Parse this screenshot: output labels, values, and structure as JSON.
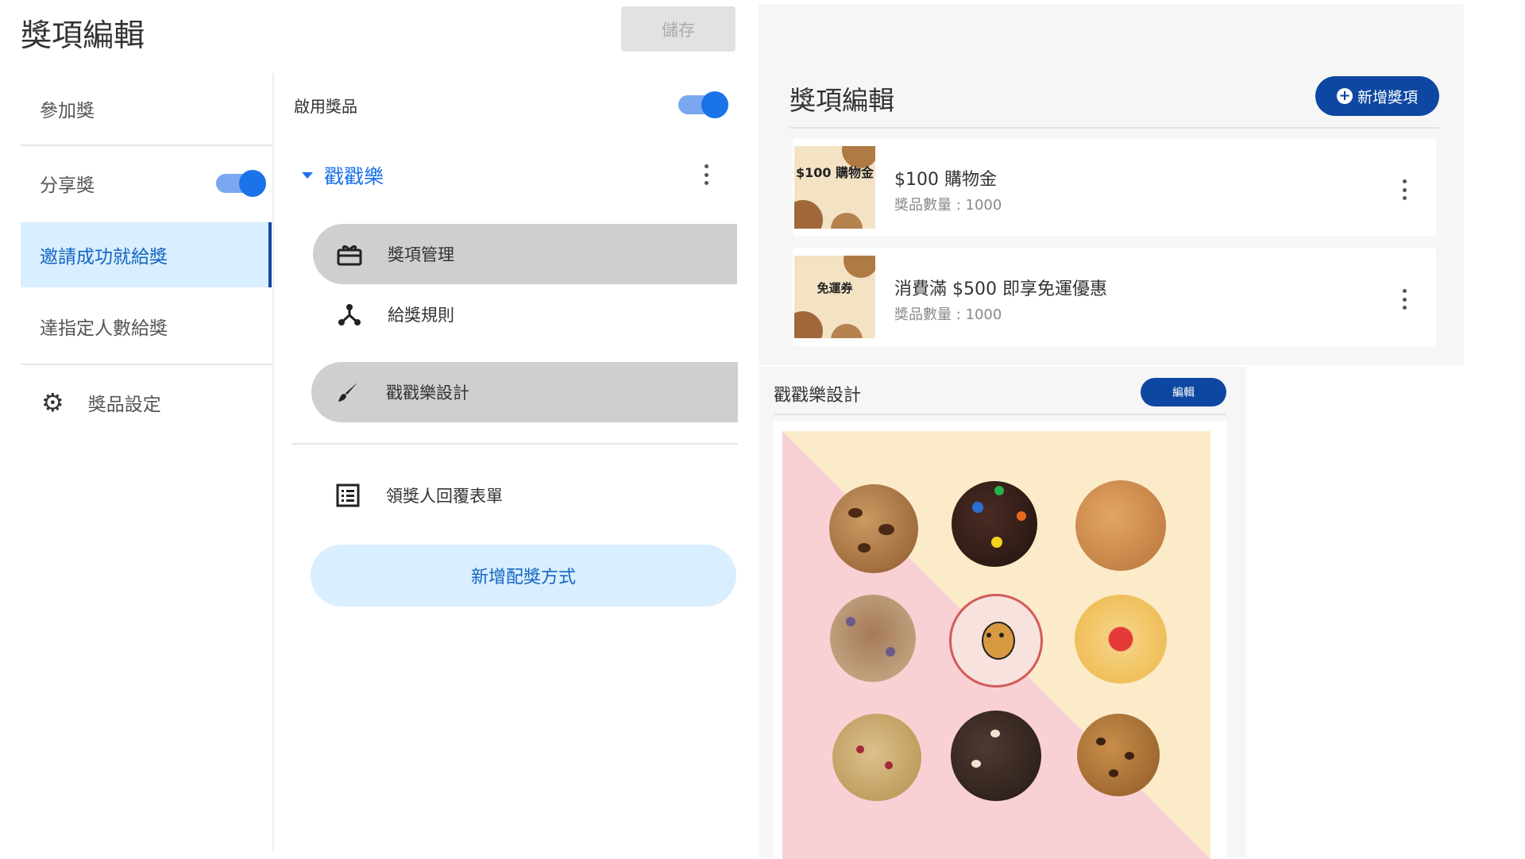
{
  "editor": {
    "title": "獎項編輯",
    "save_label": "儲存"
  },
  "sidebar": {
    "items": [
      {
        "label": "參加獎"
      },
      {
        "label": "分享獎",
        "toggle_on": true
      },
      {
        "label": "邀請成功就給獎",
        "active": true
      },
      {
        "label": "達指定人數給獎"
      }
    ],
    "settings_label": "獎品設定"
  },
  "config": {
    "enable_label": "啟用獎品",
    "enable_on": true,
    "section_label": "戳戳樂",
    "menu": [
      {
        "label": "獎項管理",
        "icon": "gift-icon",
        "selected": true
      },
      {
        "label": "給獎規則",
        "icon": "fork-icon",
        "selected": false
      },
      {
        "label": "戳戳樂設計",
        "icon": "brush-icon",
        "selected": true
      }
    ],
    "form_label": "領獎人回覆表單",
    "add_method_label": "新增配獎方式"
  },
  "prize_panel": {
    "title": "獎項編輯",
    "add_label": "新增獎項",
    "items": [
      {
        "name": "$100 購物金",
        "qty": "獎品數量 : 1000",
        "thumb_text": "$100 購物金"
      },
      {
        "name": "消費滿 $500 即享免運優惠",
        "qty": "獎品數量 : 1000",
        "thumb_text": "免運券"
      }
    ]
  },
  "design_panel": {
    "title": "戳戳樂設計",
    "edit_label": "編輯"
  },
  "colors": {
    "accent": "#0d47a1",
    "active_bg": "#d9eeff",
    "toggle": "#1a73e8",
    "canvas_top": "#fcebc9",
    "canvas_bottom": "#f9d1d4"
  }
}
